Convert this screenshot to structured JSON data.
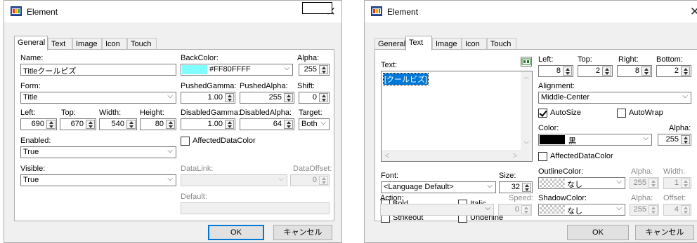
{
  "dialog_title": "Element",
  "tabs": [
    "General",
    "Text",
    "Image",
    "Icon",
    "Touch"
  ],
  "ok_label": "OK",
  "cancel_label": "キャンセル",
  "general": {
    "name_label": "Name:",
    "name_value": "Titleクールビズ",
    "form_label": "Form:",
    "form_value": "Title",
    "left_label": "Left:",
    "left_value": "690",
    "top_label": "Top:",
    "top_value": "670",
    "width_label": "Width:",
    "width_value": "540",
    "height_label": "Height:",
    "height_value": "80",
    "enabled_label": "Enabled:",
    "enabled_value": "True",
    "visible_label": "Visible:",
    "visible_value": "True",
    "backcolor_label": "BackColor:",
    "backcolor_value": "#FF80FFFF",
    "backcolor_swatch": "#80ffff",
    "alpha_label": "Alpha:",
    "alpha_value": "255",
    "pushedgamma_label": "PushedGamma:",
    "pushedgamma_value": "1.00",
    "pushedalpha_label": "PushedAlpha:",
    "pushedalpha_value": "255",
    "shift_label": "Shift:",
    "shift_value": "0",
    "disabledgamma_label": "DisabledGamma:",
    "disabledgamma_value": "1.00",
    "disabledalpha_label": "DisabledAlpha:",
    "disabledalpha_value": "64",
    "target_label": "Target:",
    "target_value": "Both",
    "affected_label": "AffectedDataColor",
    "datalink_label": "DataLink:",
    "dataoffset_label": "DataOffset:",
    "dataoffset_value": "0",
    "default_label": "Default:"
  },
  "text_tab": {
    "text_label": "Text:",
    "text_value": "[クールビズ]",
    "left_label": "Left:",
    "left_value": "8",
    "top_label": "Top:",
    "top_value": "2",
    "right_label": "Right:",
    "right_value": "8",
    "bottom_label": "Bottom:",
    "bottom_value": "2",
    "alignment_label": "Alignment:",
    "alignment_value": "Middle-Center",
    "autosize_label": "AutoSize",
    "autowrap_label": "AutoWrap",
    "color_label": "Color:",
    "color_value": "黒",
    "color_swatch": "#000000",
    "alpha_label": "Alpha:",
    "alpha_value": "255",
    "font_label": "Font:",
    "font_value": "<Language Default>",
    "size_label": "Size:",
    "size_value": "32",
    "affected_label": "AffectedDataColor",
    "bold_label": "Bold",
    "italic_label": "Italic",
    "strikeout_label": "Strikeout",
    "underline_label": "Underline",
    "outlinecolor_label": "OutlineColor:",
    "outline_value": "なし",
    "outline_alpha_label": "Alpha:",
    "outline_alpha_value": "255",
    "outline_width_label": "Width:",
    "outline_width_value": "1",
    "action_label": "Action:",
    "speed_label": "Speed:",
    "speed_value": "0",
    "shadowcolor_label": "ShadowColor:",
    "shadow_value": "なし",
    "shadow_alpha_label": "Alpha:",
    "shadow_alpha_value": "255",
    "shadow_offset_label": "Offset:",
    "shadow_offset_value": "4"
  }
}
